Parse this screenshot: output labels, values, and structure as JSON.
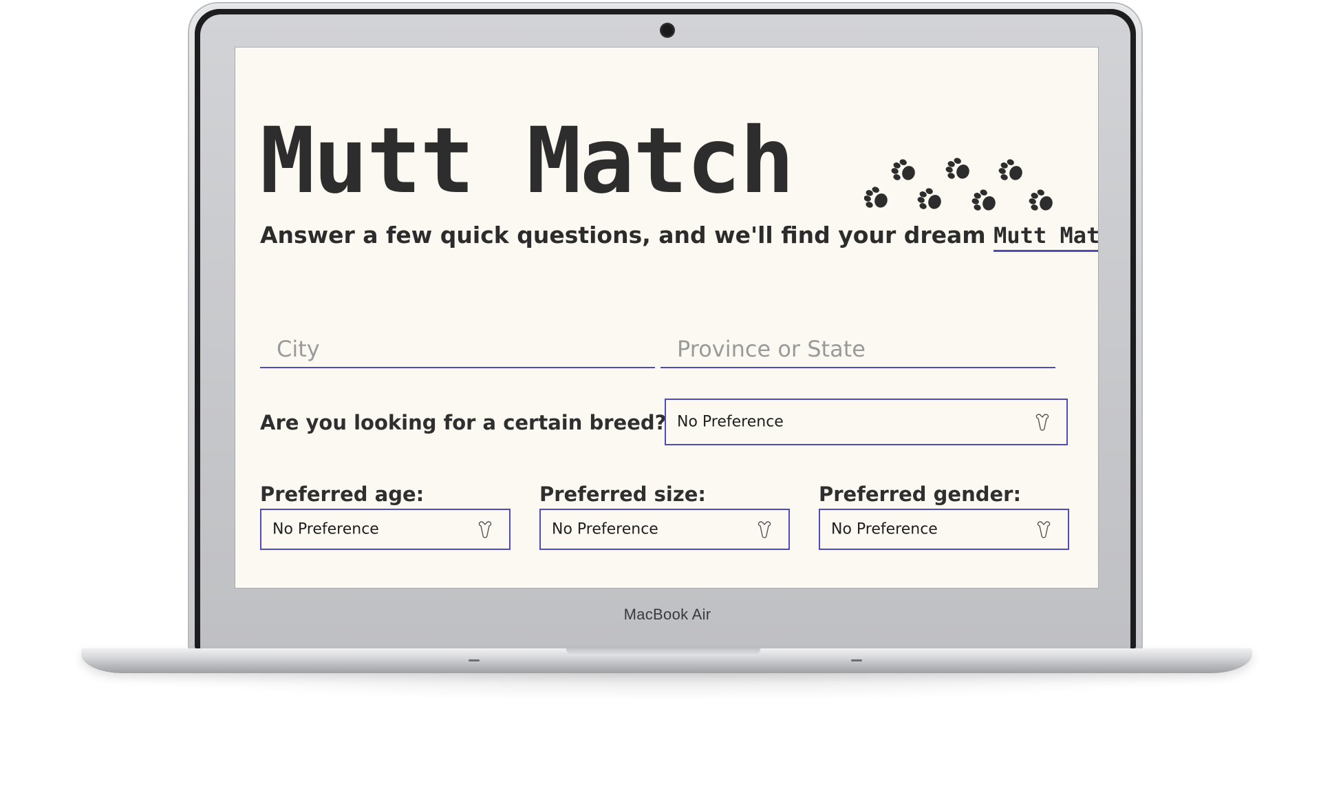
{
  "device": {
    "brand_label": "MacBook Air"
  },
  "app": {
    "title": "Mutt Match",
    "tagline_prefix": "Answer a few quick questions, and we'll find your dream ",
    "tagline_brand": "Mutt Match",
    "tagline_suffix": "."
  },
  "location": {
    "city_placeholder": "City",
    "province_placeholder": "Province or State"
  },
  "breed": {
    "question": "Are you looking for a certain breed?",
    "selected": "No Preference"
  },
  "preferences": {
    "age": {
      "label": "Preferred age:",
      "selected": "No Preference"
    },
    "size": {
      "label": "Preferred size:",
      "selected": "No Preference"
    },
    "gender": {
      "label": "Preferred gender:",
      "selected": "No Preference"
    }
  },
  "colors": {
    "accent": "#4d4ac0",
    "background": "#fcf9f3",
    "text": "#2d2d2d"
  }
}
